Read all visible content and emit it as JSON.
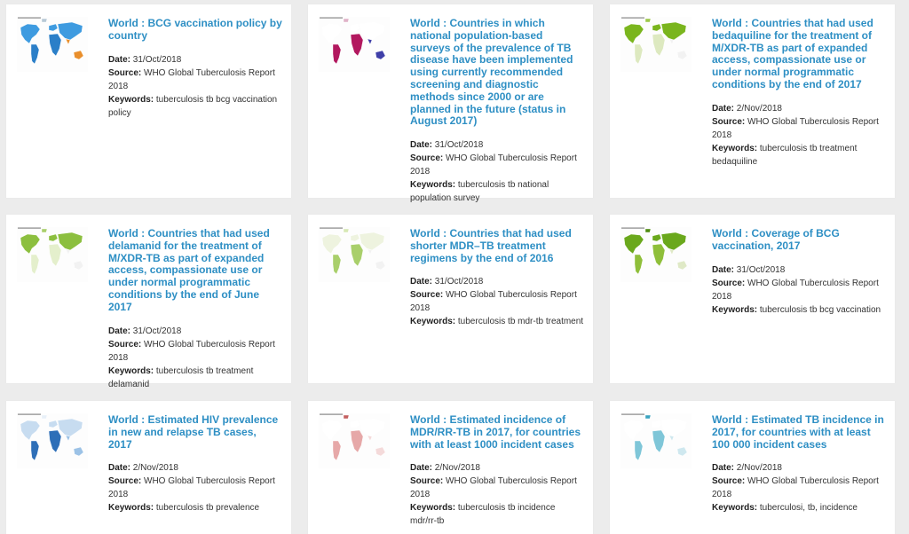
{
  "labels": {
    "date": "Date:",
    "source": "Source:",
    "keywords": "Keywords:"
  },
  "cards": [
    {
      "title": "World : BCG vaccination policy by country",
      "date": "31/Oct/2018",
      "source": "WHO Global Tuberculosis Report 2018",
      "keywords": "tuberculosis tb bcg vaccination policy",
      "thumb_caption": "BCG vaccination policy",
      "map_colors": [
        "#3e9be0",
        "#2b7fc8",
        "#e98f2c",
        "#b8c9d6"
      ]
    },
    {
      "title": "World : Countries in which national population-based surveys of the prevalence of TB disease have been implemented using currently recommended screening and diagnostic methods since 2000 or are planned in the future (status in August 2017)",
      "date": "31/Oct/2018",
      "source": "WHO Global Tuberculosis Report 2018",
      "keywords": "tuberculosis tb national population survey",
      "thumb_caption": "",
      "map_colors": [
        "#ffffff",
        "#b2185f",
        "#3f3fa8",
        "#e0b3c8"
      ]
    },
    {
      "title": "World : Countries that had used bedaquiline for the treatment of M/XDR-TB as part of expanded access, compassionate use or under normal programmatic conditions by the end of 2017",
      "date": "2/Nov/2018",
      "source": "WHO Global Tuberculosis Report 2018",
      "keywords": "tuberculosis tb treatment bedaquiline",
      "thumb_caption": "",
      "map_colors": [
        "#7ab51d",
        "#dde9c0",
        "#f2f2f2",
        "#9cc84a"
      ]
    },
    {
      "title": "World : Countries that had used delamanid for the treatment of M/XDR-TB as part of expanded access, compassionate use or under normal programmatic conditions by the end of June 2017",
      "date": "31/Oct/2018",
      "source": "WHO Global Tuberculosis Report 2018",
      "keywords": "tuberculosis tb treatment delamanid",
      "thumb_caption": "",
      "map_colors": [
        "#8cbf3f",
        "#e4efcc",
        "#f2f2f2",
        "#a9cf6b"
      ]
    },
    {
      "title": "World : Countries that had used shorter MDR–TB treatment regimens by the end of 2016",
      "date": "31/Oct/2018",
      "source": "WHO Global Tuberculosis Report 2018",
      "keywords": "tuberculosis tb mdr-tb treatment",
      "thumb_caption": "",
      "map_colors": [
        "#eef3df",
        "#a9cf6b",
        "#f2f2f2",
        "#d7e8b5"
      ]
    },
    {
      "title": "World : Coverage of BCG vaccination, 2017",
      "date": "31/Oct/2018",
      "source": "WHO Global Tuberculosis Report 2018",
      "keywords": "tuberculosis tb bcg vaccination",
      "thumb_caption": "",
      "map_colors": [
        "#6aa81c",
        "#8fbf3a",
        "#dfe9c6",
        "#4f8c12"
      ]
    },
    {
      "title": "World : Estimated HIV prevalence in new and relapse TB cases, 2017",
      "date": "2/Nov/2018",
      "source": "WHO Global Tuberculosis Report 2018",
      "keywords": "tuberculosis tb prevalence",
      "thumb_caption": "",
      "map_colors": [
        "#c7dcf0",
        "#2e6fb8",
        "#9cc2e6",
        "#e8f0f8"
      ]
    },
    {
      "title": "World : Estimated incidence of MDR/RR-TB in 2017, for countries with at least 1000 incident cases",
      "date": "2/Nov/2018",
      "source": "WHO Global Tuberculosis Report 2018",
      "keywords": "tuberculosis tb incidence mdr/rr-tb",
      "thumb_caption": "",
      "map_colors": [
        "#ffffff",
        "#e6a8a8",
        "#f4dada",
        "#c46060"
      ]
    },
    {
      "title": "World : Estimated TB incidence in 2017, for countries with at least 100 000 incident cases",
      "date": "2/Nov/2018",
      "source": "WHO Global Tuberculosis Report 2018",
      "keywords": "tuberculosi, tb, incidence",
      "thumb_caption": "",
      "map_colors": [
        "#ffffff",
        "#7fc6d8",
        "#cfe8ef",
        "#3aa3c0"
      ]
    }
  ]
}
